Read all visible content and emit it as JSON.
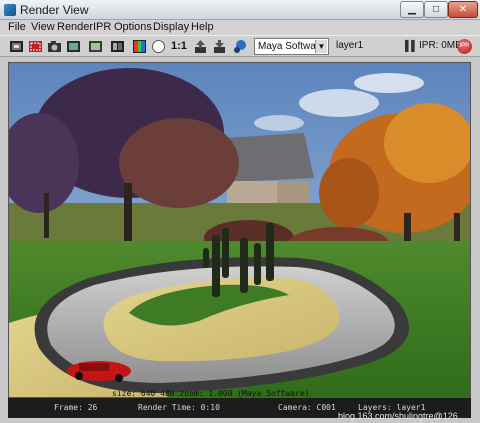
{
  "window": {
    "title": "Render View"
  },
  "menu": [
    "File",
    "View",
    "Render",
    "IPR",
    "Options",
    "Display",
    "Help"
  ],
  "toolbar": {
    "ratio_label": "1:1",
    "renderer": "Maya Software",
    "layer": "layer1",
    "ipr_label": "IPR: 0MB",
    "ipr_badge": "IPR"
  },
  "render_info": "size:  640  480  zoom: 1.000      (Maya Software)",
  "status": {
    "frame": "Frame: 26",
    "render_time": "Render Time: 0:10",
    "camera": "Camera: C001",
    "layers": "Layers: layer1"
  },
  "watermark": "blog.163.com/shulingtre@126",
  "icons": [
    "redo-render-icon",
    "render-region-icon",
    "snapshot-icon",
    "ipr-icon",
    "refresh-ipr-icon",
    "rgb-channels-icon",
    "alpha-channel-icon",
    "real-size-icon",
    "keep-image-icon",
    "remove-image-icon",
    "display-render-globals-icon",
    "pause-icon"
  ]
}
